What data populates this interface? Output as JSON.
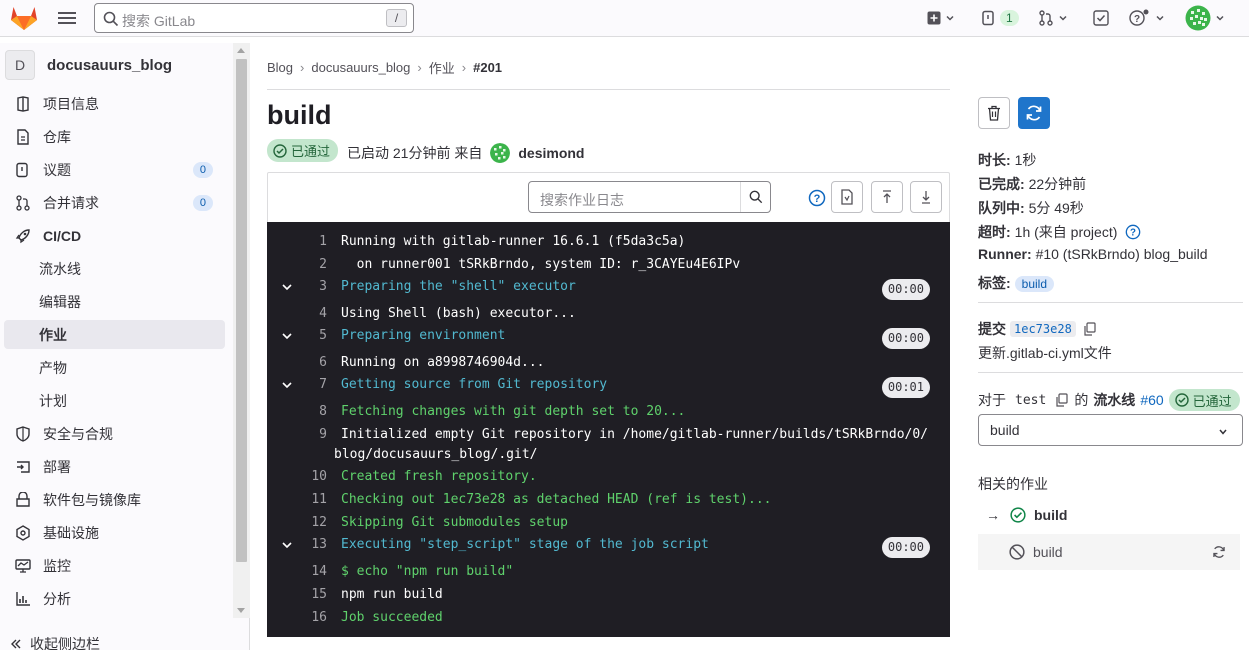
{
  "topbar": {
    "search_placeholder": "搜索 GitLab",
    "search_shortcut": "/",
    "issues_count": "1"
  },
  "sidebar": {
    "project_initial": "D",
    "project_name": "docusauurs_blog",
    "items": [
      {
        "label": "项目信息",
        "icon": "project-info-icon"
      },
      {
        "label": "仓库",
        "icon": "repository-icon"
      },
      {
        "label": "议题",
        "icon": "issues-icon",
        "count": "0"
      },
      {
        "label": "合并请求",
        "icon": "merge-request-icon",
        "count": "0"
      },
      {
        "label": "CI/CD",
        "icon": "rocket-icon"
      }
    ],
    "cicd_sub": [
      {
        "label": "流水线"
      },
      {
        "label": "编辑器"
      },
      {
        "label": "作业"
      },
      {
        "label": "产物"
      },
      {
        "label": "计划"
      }
    ],
    "items2": [
      {
        "label": "安全与合规",
        "icon": "shield-icon"
      },
      {
        "label": "部署",
        "icon": "deploy-icon"
      },
      {
        "label": "软件包与镜像库",
        "icon": "package-icon"
      },
      {
        "label": "基础设施",
        "icon": "infrastructure-icon"
      },
      {
        "label": "监控",
        "icon": "monitor-icon"
      },
      {
        "label": "分析",
        "icon": "chart-icon"
      }
    ],
    "collapse_label": "收起侧边栏"
  },
  "breadcrumb": [
    "Blog",
    "docusauurs_blog",
    "作业",
    "#201"
  ],
  "job": {
    "title": "build",
    "status": "已通过",
    "started": "已启动 21分钟前 来自",
    "user": "desimond"
  },
  "log_toolbar": {
    "search_placeholder": "搜索作业日志"
  },
  "log": [
    {
      "n": "1",
      "text": "Running with gitlab-runner 16.6.1 (f5da3c5a)",
      "kind": "wht"
    },
    {
      "n": "2",
      "text": "  on runner001 tSRkBrndo, system ID: r_3CAYEu4E6IPv",
      "kind": "wht"
    },
    {
      "n": "3",
      "text": "Preparing the \"shell\" executor",
      "kind": "sec",
      "dur": "00:00"
    },
    {
      "n": "4",
      "text": "Using Shell (bash) executor...",
      "kind": "wht"
    },
    {
      "n": "5",
      "text": "Preparing environment",
      "kind": "sec",
      "dur": "00:00"
    },
    {
      "n": "6",
      "text": "Running on a8998746904d...",
      "kind": "wht"
    },
    {
      "n": "7",
      "text": "Getting source from Git repository",
      "kind": "sec",
      "dur": "00:01"
    },
    {
      "n": "8",
      "text": "Fetching changes with git depth set to 20...",
      "kind": "grn"
    },
    {
      "n": "9",
      "text": "Initialized empty Git repository in /home/gitlab-runner/builds/tSRkBrndo/0/",
      "kind": "wht",
      "text2": "blog/docusauurs_blog/.git/"
    },
    {
      "n": "10",
      "text": "Created fresh repository.",
      "kind": "grn"
    },
    {
      "n": "11",
      "text": "Checking out 1ec73e28 as detached HEAD (ref is test)...",
      "kind": "grn"
    },
    {
      "n": "12",
      "text": "Skipping Git submodules setup",
      "kind": "grn"
    },
    {
      "n": "13",
      "text": "Executing \"step_script\" stage of the job script",
      "kind": "sec",
      "dur": "00:00"
    },
    {
      "n": "14",
      "text": "$ echo \"npm run build\"",
      "kind": "grn"
    },
    {
      "n": "15",
      "text": "npm run build",
      "kind": "wht"
    },
    {
      "n": "16",
      "text": "Job succeeded",
      "kind": "grn"
    }
  ],
  "details": {
    "duration_label": "时长:",
    "duration": "1秒",
    "finished_label": "已完成:",
    "finished": "22分钟前",
    "queued_label": "队列中:",
    "queued": "5分 49秒",
    "timeout_label": "超时:",
    "timeout": "1h (来自 project)",
    "runner_label": "Runner:",
    "runner": "#10 (tSRkBrndo) blog_build",
    "tags_label": "标签:",
    "tag": "build"
  },
  "commit": {
    "label": "提交",
    "sha": "1ec73e28",
    "message": "更新.gitlab-ci.yml文件"
  },
  "pipeline": {
    "prefix": "对于",
    "ref": "test",
    "of": "的",
    "label": "流水线",
    "id": "#60",
    "status": "已通过",
    "stage": "build"
  },
  "related": {
    "title": "相关的作业",
    "jobs": [
      {
        "name": "build",
        "arrow": "→"
      },
      {
        "name": "build"
      }
    ]
  },
  "colors": {
    "accent": "#1f75cb",
    "success": "#108548",
    "log_bg": "#1f1e24"
  }
}
